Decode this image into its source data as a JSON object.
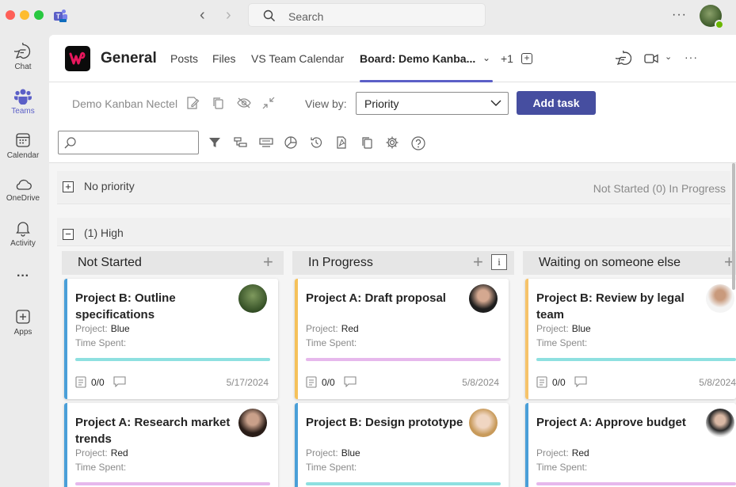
{
  "titlebar": {
    "search_placeholder": "Search",
    "more": "···"
  },
  "rail": {
    "items": [
      {
        "label": "Chat",
        "icon": "chat-icon"
      },
      {
        "label": "Teams",
        "icon": "teams-icon",
        "active": true
      },
      {
        "label": "Calendar",
        "icon": "calendar-icon"
      },
      {
        "label": "OneDrive",
        "icon": "cloud-icon"
      },
      {
        "label": "Activity",
        "icon": "bell-icon"
      },
      {
        "label": "···",
        "icon": "more-icon"
      },
      {
        "label": "Apps",
        "icon": "add-apps-icon"
      }
    ]
  },
  "channel": {
    "name": "General",
    "tabs": [
      "Posts",
      "Files",
      "VS Team Calendar",
      "Board: Demo Kanba..."
    ],
    "overflow_count": "+1",
    "header_more": "···"
  },
  "toolbar": {
    "board_name": "Demo Kanban Nectel",
    "view_by_label": "View by:",
    "view_by_value": "Priority",
    "add_task": "Add task",
    "filter_placeholder": ""
  },
  "groups": [
    {
      "title": "No priority",
      "collapsed": true,
      "summary": "Not Started (0)  In Progress"
    },
    {
      "title": "(1) High",
      "collapsed": false,
      "columns": [
        {
          "title": "Not Started",
          "cards": [
            {
              "title": "Project B: Outline specifications",
              "project_label": "Project:",
              "project": "Blue",
              "time_label": "Time Spent:",
              "checklist": "0/0",
              "date": "5/17/2024"
            },
            {
              "title": "Project A: Research market trends",
              "project_label": "Project:",
              "project": "Red",
              "time_label": "Time Spent:"
            }
          ]
        },
        {
          "title": "In Progress",
          "cards": [
            {
              "title": "Project A: Draft proposal",
              "project_label": "Project:",
              "project": "Red",
              "time_label": "Time Spent:",
              "checklist": "0/0",
              "date": "5/8/2024"
            },
            {
              "title": "Project B: Design prototype",
              "project_label": "Project:",
              "project": "Blue",
              "time_label": "Time Spent:"
            }
          ]
        },
        {
          "title": "Waiting on someone else",
          "cards": [
            {
              "title": "Project B: Review by legal team",
              "project_label": "Project:",
              "project": "Blue",
              "time_label": "Time Spent:",
              "checklist": "0/0",
              "date": "5/8/2024"
            },
            {
              "title": "Project A: Approve budget",
              "project_label": "Project:",
              "project": "Red",
              "time_label": "Time Spent:"
            }
          ]
        }
      ]
    }
  ],
  "colors": {
    "accent": "#5b5fc7",
    "add_task_button": "#464ea0",
    "card_blue": "#4a9fd8",
    "card_yellow": "#f5c15a",
    "card_orange": "#f6c36a",
    "bar_cyan": "#8ee0e0",
    "bar_pink": "#e6b8ec"
  }
}
